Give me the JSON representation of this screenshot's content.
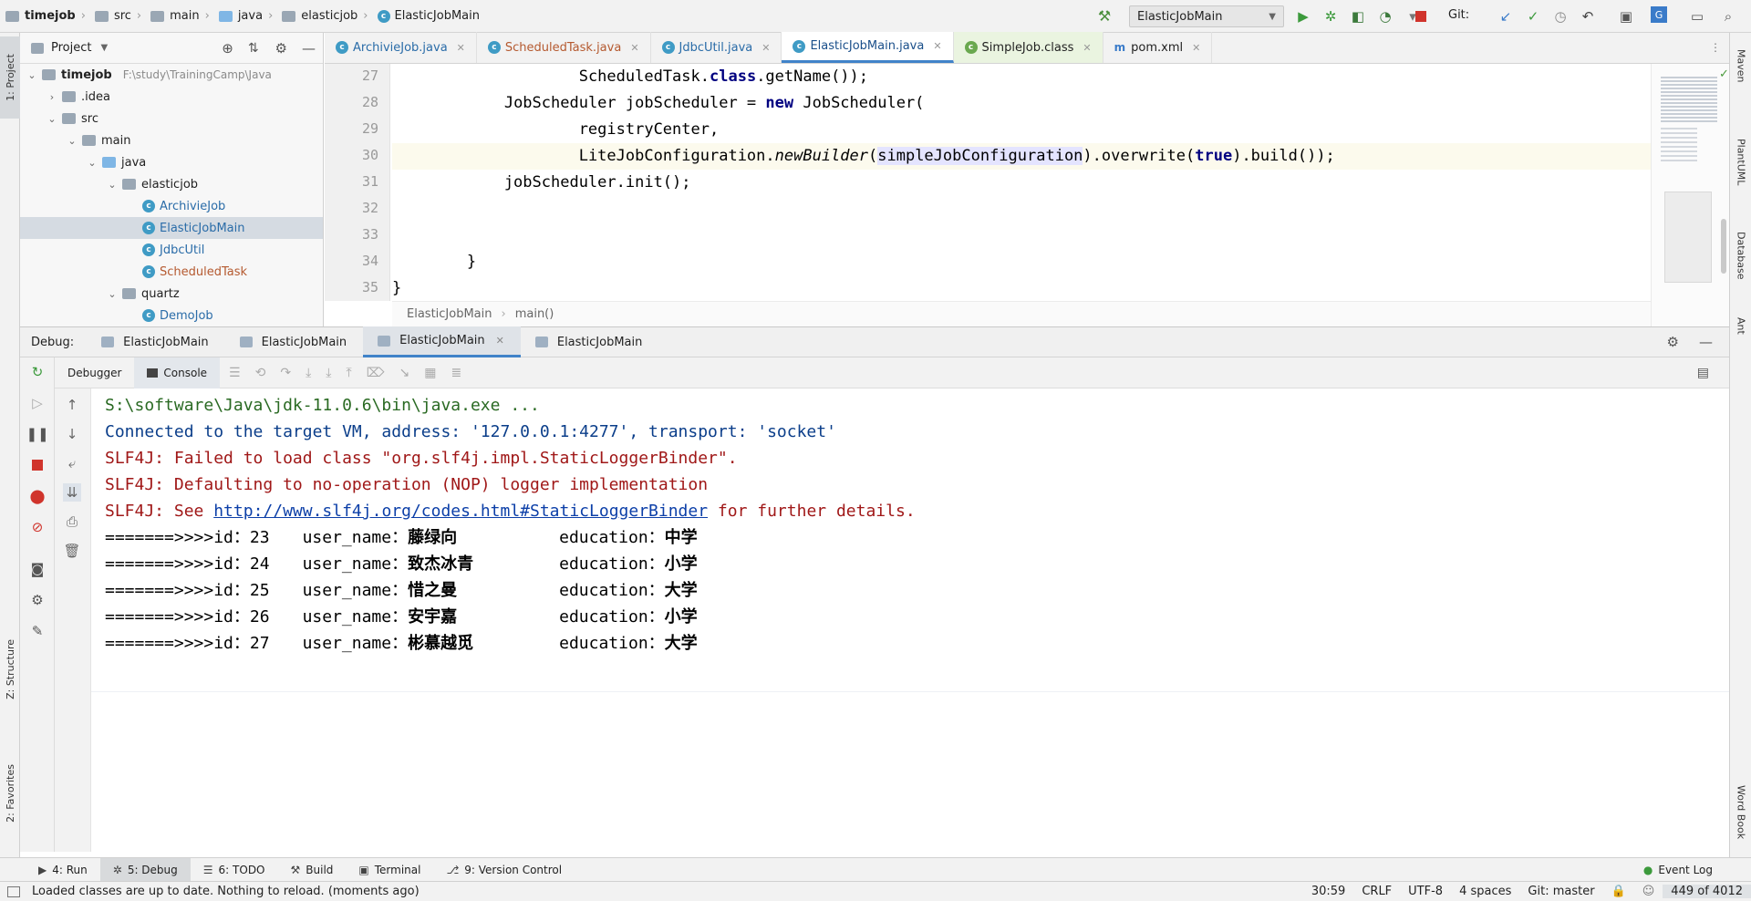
{
  "navbar": {
    "breadcrumb": [
      "timejob",
      "src",
      "main",
      "java",
      "elasticjob",
      "ElasticJobMain"
    ],
    "run_config": "ElasticJobMain",
    "git_label": "Git:"
  },
  "left_tool_tabs": [
    "1: Project",
    "Z: Structure",
    "2: Favorites"
  ],
  "right_tool_tabs": [
    "Maven",
    "PlantUML",
    "Database",
    "Ant",
    "Word Book"
  ],
  "project": {
    "title": "Project",
    "tree": [
      {
        "label": "timejob",
        "path": "F:\\study\\TrainingCamp\\Java",
        "bold": true,
        "expanded": true
      },
      {
        "label": ".idea",
        "expanded": false
      },
      {
        "label": "src",
        "expanded": true
      },
      {
        "label": "main",
        "expanded": true
      },
      {
        "label": "java",
        "expanded": true
      },
      {
        "label": "elasticjob",
        "expanded": true
      },
      {
        "label": "ArchivieJob"
      },
      {
        "label": "ElasticJobMain",
        "selected": true
      },
      {
        "label": "JdbcUtil"
      },
      {
        "label": "ScheduledTask"
      },
      {
        "label": "quartz",
        "expanded": true
      },
      {
        "label": "DemoJob"
      }
    ]
  },
  "editor": {
    "tabs": [
      "ArchivieJob.java",
      "ScheduledTask.java",
      "JdbcUtil.java",
      "ElasticJobMain.java",
      "SimpleJob.class",
      "pom.xml"
    ],
    "active_tab": "ElasticJobMain.java",
    "line_numbers": [
      "27",
      "28",
      "29",
      "30",
      "31",
      "32",
      "33",
      "34",
      "35"
    ],
    "code": {
      "l27_indent": "                    ",
      "l27_a": "ScheduledTask.",
      "l27_kw": "class",
      "l27_b": ".getName());",
      "l28_indent": "            ",
      "l28_a": "JobScheduler jobScheduler = ",
      "l28_kw": "new",
      "l28_b": " JobScheduler(",
      "l29": "                    registryCenter,",
      "l30_indent": "                    ",
      "l30_a": "LiteJobConfiguration.",
      "l30_it": "newBuilder",
      "l30_p": "(",
      "l30_var": "simpleJobConfiguration",
      "l30_b": ").overwrite(",
      "l30_kw": "true",
      "l30_c": ").build());",
      "l31": "            jobScheduler.init();",
      "l32": "",
      "l33": "",
      "l34": "        }",
      "l35": "}"
    },
    "breadcrumb": [
      "ElasticJobMain",
      "main()"
    ]
  },
  "debug": {
    "label": "Debug:",
    "tabs": [
      "ElasticJobMain",
      "ElasticJobMain",
      "ElasticJobMain",
      "ElasticJobMain"
    ],
    "active_tab_index": 2,
    "subtabs": [
      "Debugger",
      "Console"
    ]
  },
  "console": {
    "cmd": "S:\\software\\Java\\jdk-11.0.6\\bin\\java.exe ...",
    "connected": "Connected to the target VM, address: '127.0.0.1:4277', transport: 'socket'",
    "err1": "SLF4J: Failed to load class \"org.slf4j.impl.StaticLoggerBinder\".",
    "err2": "SLF4J: Defaulting to no-operation (NOP) logger implementation",
    "err3_a": "SLF4J: See ",
    "err3_link": "http://www.slf4j.org/codes.html#StaticLoggerBinder",
    "err3_b": " for further details.",
    "rows": [
      {
        "prefix": "=======>>>>id：",
        "id": "23",
        "name_label": "user_name：",
        "name": "藤绿向",
        "edu_label": "education：",
        "edu": "中学"
      },
      {
        "prefix": "=======>>>>id：",
        "id": "24",
        "name_label": "user_name：",
        "name": "致杰冰青",
        "edu_label": "education：",
        "edu": "小学"
      },
      {
        "prefix": "=======>>>>id：",
        "id": "25",
        "name_label": "user_name：",
        "name": "惜之曼",
        "edu_label": "education：",
        "edu": "大学"
      },
      {
        "prefix": "=======>>>>id：",
        "id": "26",
        "name_label": "user_name：",
        "name": "安宇嘉",
        "edu_label": "education：",
        "edu": "小学"
      },
      {
        "prefix": "=======>>>>id：",
        "id": "27",
        "name_label": "user_name：",
        "name": "彬慕越觅",
        "edu_label": "education：",
        "edu": "大学"
      }
    ]
  },
  "bottom_tabs": [
    {
      "label": "4: Run"
    },
    {
      "label": "5: Debug",
      "active": true
    },
    {
      "label": "6: TODO"
    },
    {
      "label": "Build"
    },
    {
      "label": "Terminal"
    },
    {
      "label": "9: Version Control"
    }
  ],
  "event_log": "Event Log",
  "status": {
    "message": "Loaded classes are up to date. Nothing to reload. (moments ago)",
    "position": "30:59",
    "line_sep": "CRLF",
    "encoding": "UTF-8",
    "indent": "4 spaces",
    "branch": "Git: master",
    "memory": "449 of 4012"
  },
  "colors": {
    "accent": "#4083c9",
    "console_cmd": "#2a6a23",
    "console_info": "#0b3e8a",
    "console_error": "#a01818",
    "run_green": "#3c9a3c",
    "stop_red": "#d0342c"
  }
}
